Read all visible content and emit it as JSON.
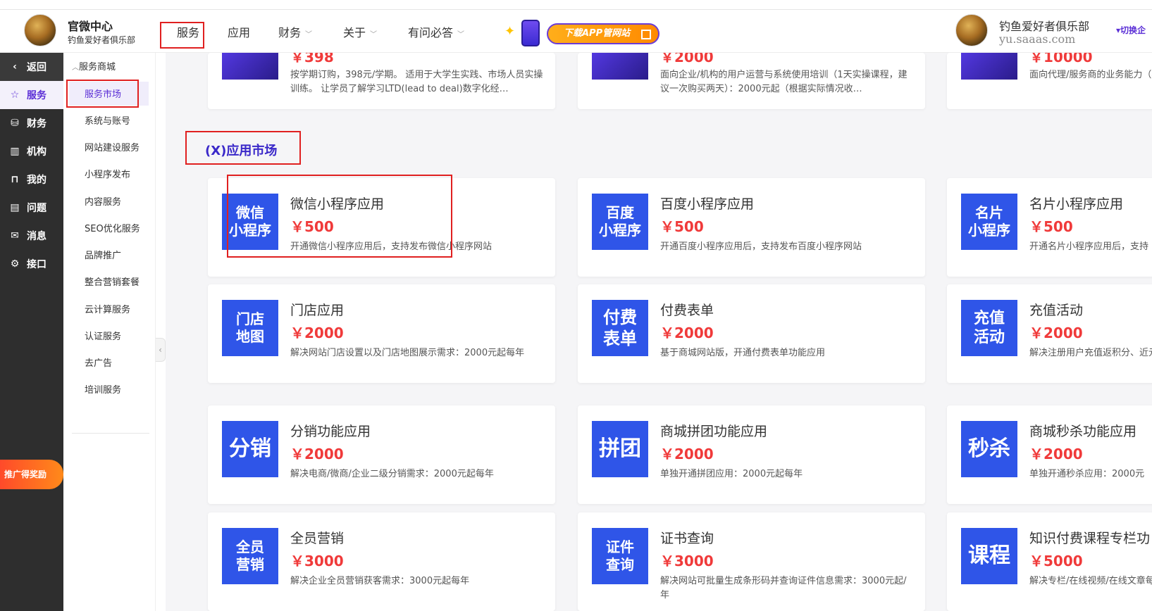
{
  "header": {
    "brand_title": "官微中心",
    "brand_subtitle": "钓鱼爱好者俱乐部",
    "nav": [
      {
        "label": "服务",
        "has_dropdown": false
      },
      {
        "label": "应用",
        "has_dropdown": false
      },
      {
        "label": "财务",
        "has_dropdown": true
      },
      {
        "label": "关于",
        "has_dropdown": true
      },
      {
        "label": "有问必答",
        "has_dropdown": true
      }
    ],
    "promo_label": "下载APP管网站",
    "user_name": "钓鱼爱好者俱乐部",
    "user_domain": "yu.saaas.com",
    "switch_label": "▾切换企"
  },
  "sidebar": {
    "back_label": "返回",
    "items": [
      {
        "label": "服务",
        "icon": "star-icon",
        "active": true
      },
      {
        "label": "财务",
        "icon": "database-icon",
        "active": false
      },
      {
        "label": "机构",
        "icon": "building-icon",
        "active": false
      },
      {
        "label": "我的",
        "icon": "bookmark-icon",
        "active": false
      },
      {
        "label": "问题",
        "icon": "document-icon",
        "active": false
      },
      {
        "label": "消息",
        "icon": "mail-icon",
        "active": false
      },
      {
        "label": "接口",
        "icon": "gear-icon",
        "active": false
      }
    ],
    "promo_badge": "推广得奖励"
  },
  "subnav": {
    "header": "服务商城",
    "items": [
      "服务市场",
      "系统与账号",
      "网站建设服务",
      "小程序发布",
      "内容服务",
      "SEO优化服务",
      "品牌推广",
      "整合营销套餐",
      "云计算服务",
      "认证服务",
      "去广告",
      "培训服务"
    ]
  },
  "top_cards": [
    {
      "price": "￥398",
      "desc": "按学期订购，398元/学期。 适用于大学生实践、市场人员实操训练。 让学员了解学习LTD(lead to deal)数字化经…"
    },
    {
      "price": "￥2000",
      "desc": "面向企业/机构的用户运营与系统使用培训（1天实操课程，建议一次购买两天）：2000元起（根据实际情况收…"
    },
    {
      "price": "￥10000",
      "desc": "面向代理/服务商的业务能力（根据实际情况收取费用）"
    }
  ],
  "section_title": "(X)应用市场",
  "app_cards": [
    {
      "thumb": "微信小程序",
      "title": "微信小程序应用",
      "price": "￥500",
      "desc": "开通微信小程序应用后，支持发布微信小程序网站"
    },
    {
      "thumb": "百度小程序",
      "title": "百度小程序应用",
      "price": "￥500",
      "desc": "开通百度小程序应用后，支持发布百度小程序网站"
    },
    {
      "thumb": "名片小程序",
      "title": "名片小程序应用",
      "price": "￥500",
      "desc": "开通名片小程序应用后，支持"
    },
    {
      "thumb": "门店地图",
      "title": "门店应用",
      "price": "￥2000",
      "desc": "解决网站门店设置以及门店地图展示需求：2000元起每年"
    },
    {
      "thumb": "付费表单",
      "title": "付费表单",
      "price": "￥2000",
      "desc": "基于商城网站版，开通付费表单功能应用"
    },
    {
      "thumb": "充值活动",
      "title": "充值活动",
      "price": "￥2000",
      "desc": "解决注册用户充值返积分、近元起每年"
    },
    {
      "thumb": "分销",
      "title": "分销功能应用",
      "price": "￥2000",
      "desc": "解决电商/微商/企业二级分销需求：2000元起每年"
    },
    {
      "thumb": "拼团",
      "title": "商城拼团功能应用",
      "price": "￥2000",
      "desc": "单独开通拼团应用：2000元起每年"
    },
    {
      "thumb": "秒杀",
      "title": "商城秒杀功能应用",
      "price": "￥2000",
      "desc": "单独开通秒杀应用：2000元"
    },
    {
      "thumb": "全员营销",
      "title": "全员营销",
      "price": "￥3000",
      "desc": "解决企业全员营销获客需求：3000元起每年"
    },
    {
      "thumb": "证书查询",
      "title": "证书查询",
      "price": "￥3000",
      "desc": "解决网站可批量生成条形码并查询证件信息需求：3000元起/年"
    },
    {
      "thumb": "课程",
      "title": "知识付费课程专栏功",
      "price": "￥5000",
      "desc": "解决专栏/在线视频/在线文章每年"
    }
  ],
  "colors": {
    "accent": "#5b2fd6",
    "price": "#f03a3a",
    "thumb": "#2f55e8",
    "annotation": "#e02020",
    "sidebar_bg": "#2e2e2e"
  }
}
